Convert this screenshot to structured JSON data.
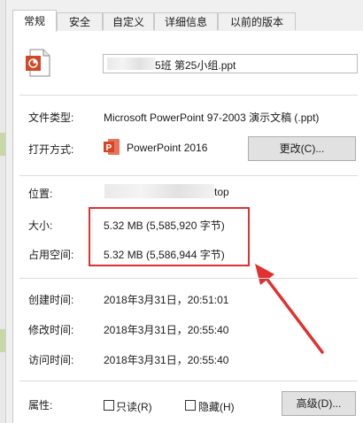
{
  "tabs": [
    "常规",
    "安全",
    "自定义",
    "详细信息",
    "以前的版本"
  ],
  "active_tab": "常规",
  "file": {
    "name_visible": "5班 第25小组.ppt",
    "icon": "ppt-file-icon"
  },
  "rows": {
    "type_label": "文件类型:",
    "type_value": "Microsoft PowerPoint 97-2003 演示文稿 (.ppt)",
    "open_label": "打开方式:",
    "open_value": "PowerPoint 2016",
    "open_icon": "powerpoint-icon",
    "change_button": "更改(C)...",
    "location_label": "位置:",
    "location_value_visible": "top",
    "size_label": "大小:",
    "size_value": "5.32 MB (5,585,920 字节)",
    "disk_label": "占用空间:",
    "disk_value": "5.32 MB (5,586,944 字节)",
    "created_label": "创建时间:",
    "created_value": "2018年3月31日，20:51:01",
    "modified_label": "修改时间:",
    "modified_value": "2018年3月31日，20:55:40",
    "accessed_label": "访问时间:",
    "accessed_value": "2018年3月31日，20:55:40",
    "attr_label": "属性:",
    "readonly_label": "只读(R)",
    "hidden_label": "隐藏(H)",
    "advanced_button": "高级(D)..."
  },
  "colors": {
    "highlight": "#e03030",
    "ppt_orange": "#d24726"
  }
}
